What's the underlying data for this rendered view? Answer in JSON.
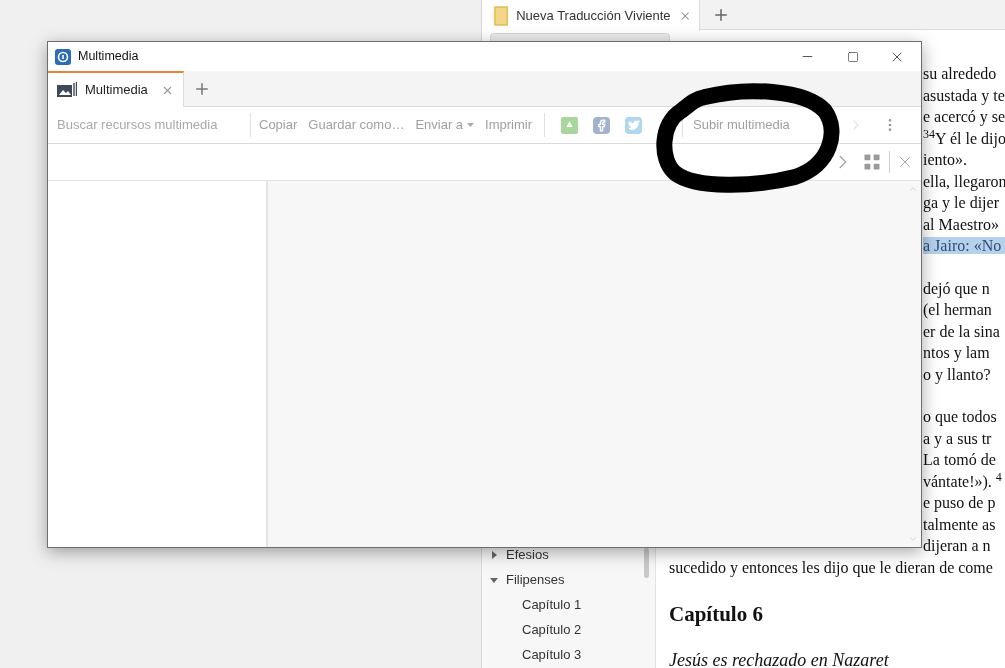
{
  "background_app": {
    "tabs": [
      {
        "title": "Nueva Traducción Viviente",
        "selected": true
      }
    ],
    "sidebar": {
      "items": [
        {
          "label": "Efesios",
          "expanded": false
        },
        {
          "label": "Filipenses",
          "expanded": true,
          "children": [
            {
              "label": "Capítulo 1"
            },
            {
              "label": "Capítulo 2"
            },
            {
              "label": "Capítulo 3"
            }
          ]
        }
      ]
    },
    "reader": {
      "paragraphs": [
        [
          {
            "kind": "clipped",
            "text": "su alrededo",
            "highlighted": false
          },
          {
            "kind": "clipped",
            "text": "asustada y te",
            "highlighted": false
          },
          {
            "kind": "clipped",
            "text": "e acercó y se",
            "highlighted": false
          },
          {
            "kind": "clipped",
            "text": "$^{34}$Y él le dijo",
            "highlighted": false
          },
          {
            "kind": "clipped",
            "text": "iento».",
            "highlighted": false
          },
          {
            "kind": "clipped",
            "text": "ella, llegaron",
            "highlighted": false
          },
          {
            "kind": "clipped",
            "text": "ga y le dijer",
            "highlighted": false
          },
          {
            "kind": "clipped",
            "text": "al Maestro»",
            "highlighted": false
          },
          {
            "kind": "clipped",
            "text": "a Jairo: «No",
            "highlighted": true
          }
        ],
        [
          {
            "kind": "clipped",
            "text": "dejó que n",
            "highlighted": false
          },
          {
            "kind": "clipped",
            "text": "(el herman",
            "highlighted": false
          },
          {
            "kind": "clipped",
            "text": "er de la sina",
            "highlighted": false
          },
          {
            "kind": "clipped",
            "text": "ntos y lam",
            "highlighted": false
          },
          {
            "kind": "clipped",
            "text": "o y llanto?",
            "highlighted": false
          }
        ],
        [
          {
            "kind": "clipped",
            "text": "o que todos",
            "highlighted": false
          },
          {
            "kind": "clipped",
            "text": "a y a sus tr",
            "highlighted": false
          },
          {
            "kind": "clipped",
            "text": "La tomó de",
            "highlighted": false
          },
          {
            "kind": "clipped",
            "text": "vántate!»). $^{4}$",
            "highlighted": false
          },
          {
            "kind": "clipped",
            "text": "e puso de p",
            "highlighted": false
          },
          {
            "kind": "clipped",
            "text": "talmente as",
            "highlighted": false
          },
          {
            "kind": "clipped",
            "text": "dijeran a n",
            "highlighted": false
          },
          {
            "kind": "full",
            "text": "sucedido y entonces les dijo que le dieran de come",
            "highlighted": false
          }
        ]
      ],
      "heading": "Capítulo 6",
      "subheading": "Jesús es rechazado en Nazaret"
    }
  },
  "window": {
    "title": "Multimedia",
    "tabs": [
      {
        "label": "Multimedia",
        "selected": true
      }
    ],
    "search": {
      "placeholder": "Buscar recursos multimedia"
    },
    "actions": [
      {
        "kind": "plain",
        "label": "Copiar"
      },
      {
        "kind": "plain",
        "label": "Guardar como…"
      },
      {
        "kind": "dropdown",
        "label": "Enviar a"
      },
      {
        "kind": "plain",
        "label": "Imprimir"
      }
    ],
    "upload_button": "Subir multimedia"
  }
}
